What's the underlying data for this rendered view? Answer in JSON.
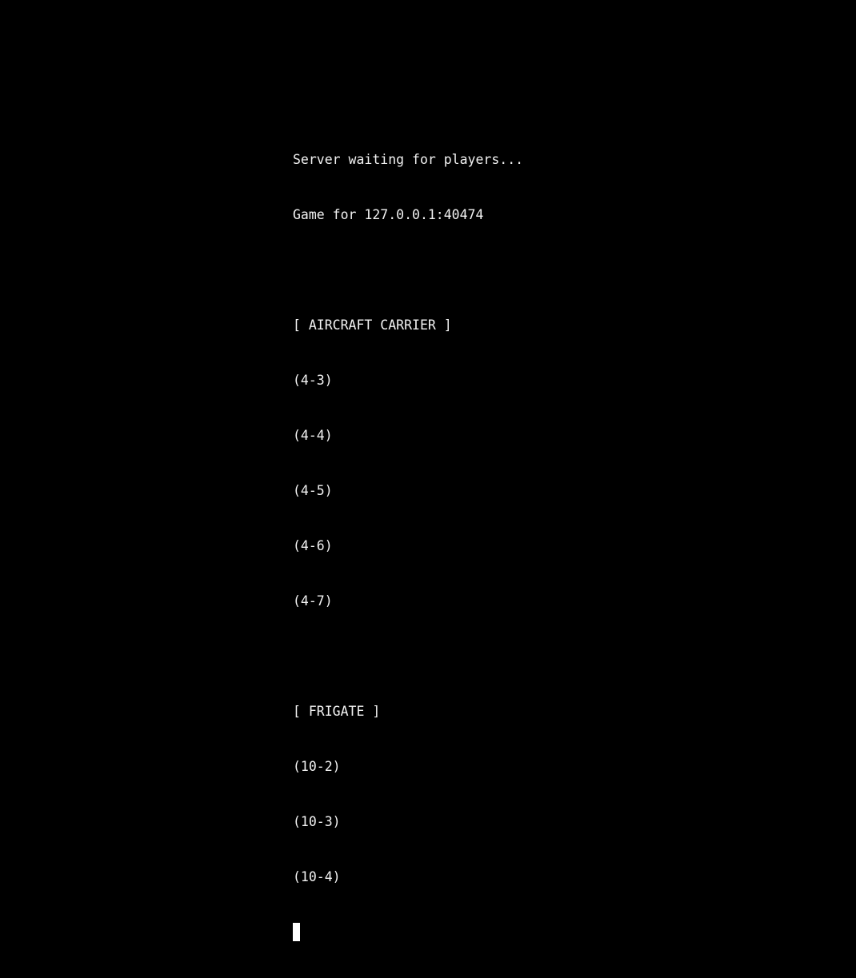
{
  "terminal": {
    "lines": [
      "Server waiting for players...",
      "Game for 127.0.0.1:40474",
      "",
      "[ AIRCRAFT CARRIER ]",
      "(4-3)",
      "(4-4)",
      "(4-5)",
      "(4-6)",
      "(4-7)",
      "",
      "[ FRIGATE ]",
      "(10-2)",
      "(10-3)",
      "(10-4)"
    ]
  },
  "colors": {
    "background": "#000000",
    "text": "#f2f2f2",
    "cursor": "#ffffff"
  }
}
